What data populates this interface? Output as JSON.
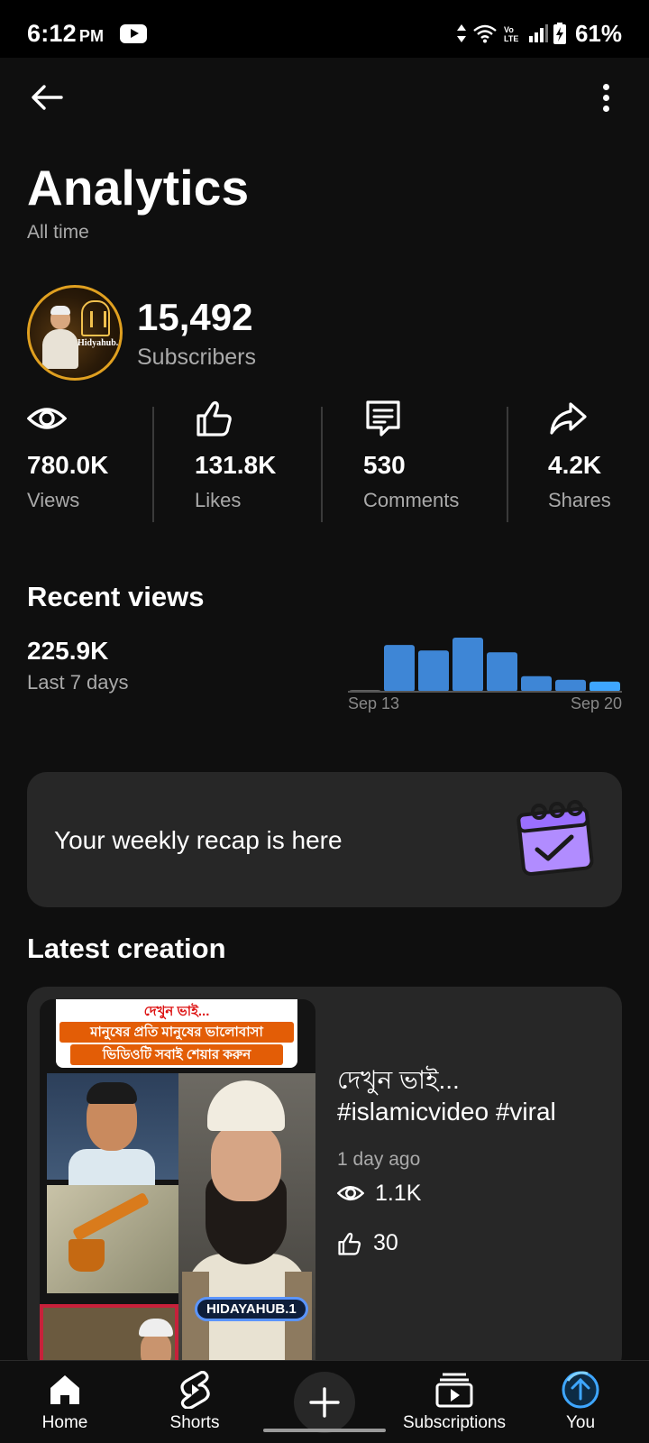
{
  "status_bar": {
    "time": "6:12",
    "ampm": "PM",
    "network_label": "Vo LTE",
    "battery": "61%"
  },
  "header": {
    "title": "Analytics",
    "subtitle": "All time",
    "back_icon": "arrow-left-icon",
    "more_icon": "more-vert-icon"
  },
  "channel": {
    "avatar_text": "Hidyahub.1",
    "subscribers_value": "15,492",
    "subscribers_label": "Subscribers"
  },
  "stats": [
    {
      "icon": "eye-icon",
      "value": "780.0K",
      "label": "Views"
    },
    {
      "icon": "thumb-up-icon",
      "value": "131.8K",
      "label": "Likes"
    },
    {
      "icon": "comment-icon",
      "value": "530",
      "label": "Comments"
    },
    {
      "icon": "share-icon",
      "value": "4.2K",
      "label": "Shares"
    }
  ],
  "recent_views": {
    "title": "Recent views",
    "value": "225.9K",
    "period": "Last 7 days"
  },
  "chart_data": {
    "type": "bar",
    "categories": [
      "Sep 13",
      "",
      "",
      "",
      "",
      "",
      "",
      "Sep 20"
    ],
    "values": [
      0,
      51,
      45,
      59,
      43,
      17,
      13,
      11
    ],
    "colors": [
      "#606060",
      "#3e86d6",
      "#3e86d6",
      "#3e86d6",
      "#3e86d6",
      "#3e86d6",
      "#3e86d6",
      "#3ea6ff"
    ],
    "title": "",
    "xlabel": "",
    "ylabel": "",
    "grid": false
  },
  "recap": {
    "text": "Your weekly recap is here",
    "icon": "calendar-check-icon"
  },
  "latest": {
    "section_title": "Latest creation",
    "thumb_line1": "দেখুন ভাই...",
    "thumb_line2": "মানুষের প্রতি মানুষের ভালোবাসা",
    "thumb_line3": "ভিডিওটি সবাই শেয়ার করুন",
    "thumb_watermark": "HIDAYAHUB.1",
    "title_line1": "দেখুন ভাই...",
    "title_line2": "#islamicvideo #viral",
    "age": "1 day ago",
    "views": "1.1K",
    "likes": "30"
  },
  "bottom_nav": {
    "home": "Home",
    "shorts": "Shorts",
    "subscriptions": "Subscriptions",
    "you": "You"
  },
  "colors": {
    "background": "#0f0f0f",
    "card": "#272727",
    "accent_blue": "#3ea6ff",
    "recap_icon": "#b18cff"
  }
}
